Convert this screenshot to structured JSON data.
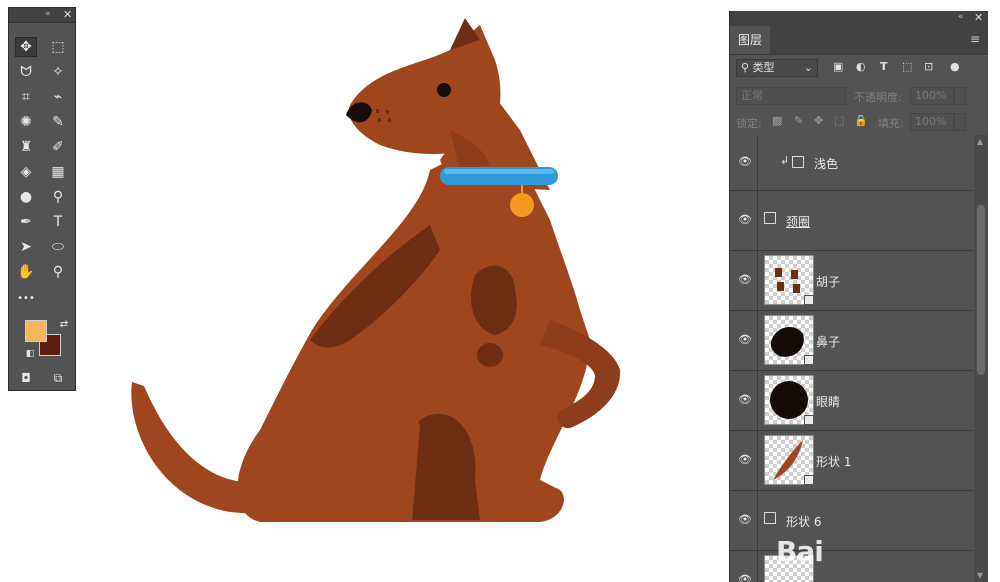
{
  "tools_panel": {
    "collapse_glyph": "«",
    "close_glyph": "✕",
    "tools": [
      {
        "name": "move-tool",
        "glyph": "✥"
      },
      {
        "name": "rect-marquee-tool",
        "glyph": "⬚"
      },
      {
        "name": "lasso-tool",
        "glyph": "ᗢ"
      },
      {
        "name": "magic-wand-tool",
        "glyph": "✧"
      },
      {
        "name": "crop-tool",
        "glyph": "⌗"
      },
      {
        "name": "eyedropper-tool",
        "glyph": "⌁"
      },
      {
        "name": "healing-brush-tool",
        "glyph": "✺"
      },
      {
        "name": "brush-tool",
        "glyph": "✎"
      },
      {
        "name": "clone-stamp-tool",
        "glyph": "♜"
      },
      {
        "name": "history-brush-tool",
        "glyph": "✐"
      },
      {
        "name": "eraser-tool",
        "glyph": "◈"
      },
      {
        "name": "gradient-tool",
        "glyph": "▦"
      },
      {
        "name": "blur-tool",
        "glyph": "●"
      },
      {
        "name": "dodge-tool",
        "glyph": "⚲"
      },
      {
        "name": "pen-tool",
        "glyph": "✒"
      },
      {
        "name": "type-tool",
        "glyph": "T"
      },
      {
        "name": "path-selection-tool",
        "glyph": "➤"
      },
      {
        "name": "ellipse-tool",
        "glyph": "⬭"
      },
      {
        "name": "hand-tool",
        "glyph": "✋"
      },
      {
        "name": "zoom-tool",
        "glyph": "⚲"
      },
      {
        "name": "more-tools",
        "glyph": "•••"
      }
    ],
    "foreground_color": "#F5B65C",
    "background_color": "#5A1E14",
    "quick_mask_glyph": "◘",
    "screen_mode_glyph": "⧉"
  },
  "layers_panel": {
    "collapse_glyph": "«",
    "close_glyph": "✕",
    "tab_label": "图层",
    "menu_glyph": "≡",
    "filter": {
      "search_glyph": "⚲",
      "kind_label": "类型",
      "filter_icons": [
        "▣",
        "◐",
        "T",
        "⬚",
        "⊡",
        "●"
      ]
    },
    "blend_mode": "正常",
    "opacity_label": "不透明度:",
    "opacity_value": "100%",
    "lock_label": "锁定:",
    "lock_icons": [
      "▩",
      "✎",
      "✥",
      "⬚",
      "🔒"
    ],
    "fill_label": "填充:",
    "fill_value": "100%",
    "layers": [
      {
        "name": "浅色",
        "kind": "shape-clipped"
      },
      {
        "name": "颈圈",
        "kind": "shape"
      },
      {
        "name": "胡子",
        "kind": "thumb",
        "thumb": "whiskers"
      },
      {
        "name": "鼻子",
        "kind": "thumb",
        "thumb": "nose"
      },
      {
        "name": "眼睛",
        "kind": "thumb",
        "thumb": "eye"
      },
      {
        "name": "形状 1",
        "kind": "thumb",
        "thumb": "shape1"
      },
      {
        "name": "形状 6",
        "kind": "shape"
      },
      {
        "name": "",
        "kind": "thumb",
        "thumb": "empty"
      }
    ]
  },
  "canvas": {
    "dog_body_color": "#A0461F",
    "dog_dark_color": "#6E2E12",
    "collar_color": "#2E9AD8",
    "tag_color": "#F39A1E"
  },
  "watermark": "Bai"
}
